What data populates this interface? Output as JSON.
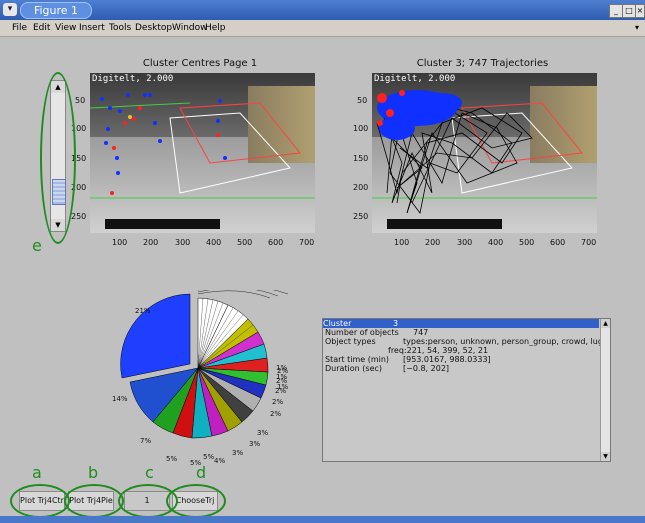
{
  "window": {
    "title": "Figure 1"
  },
  "menu": [
    "File",
    "Edit",
    "View",
    "Insert",
    "Tools",
    "Desktop",
    "Window",
    "Help"
  ],
  "plots": [
    {
      "title": "Cluster Centres Page 1",
      "overlay": "Digitelt, 2.000",
      "y_ticks": [
        "50",
        "100",
        "150",
        "200",
        "250"
      ],
      "x_ticks": [
        "100",
        "200",
        "300",
        "400",
        "500",
        "600",
        "700"
      ]
    },
    {
      "title": "Cluster 3; 747 Trajectories",
      "overlay": "Digitelt, 2.000",
      "y_ticks": [
        "50",
        "100",
        "150",
        "200",
        "250"
      ],
      "x_ticks": [
        "100",
        "200",
        "300",
        "400",
        "500",
        "600",
        "700"
      ]
    }
  ],
  "pie": {
    "labels": [
      "21%",
      "14%",
      "7%",
      "5%",
      "5%",
      "5%",
      "4%",
      "3%",
      "3%",
      "3%",
      "2%",
      "2%",
      "2%",
      "2%",
      "2%",
      "1%",
      "1%",
      "1%"
    ],
    "colors": [
      "#1f3fff",
      "#ffffff",
      "#2050d0",
      "#20a020",
      "#d01010",
      "#10a0b0",
      "#c020c0",
      "#a0a000",
      "#303030",
      "#b0b0b0"
    ]
  },
  "info": {
    "rows": [
      {
        "label": "Cluster",
        "value": "3"
      },
      {
        "label": "Number of objects",
        "value": "747"
      },
      {
        "label": "Object types",
        "value": "types:person, unknown, person_group, crowd, luggage"
      },
      {
        "label": "",
        "value": "freq:221, 54, 399, 52, 21"
      },
      {
        "label": "Start time (min)",
        "value": "[953.0167, 988.0333]"
      },
      {
        "label": "Duration (sec)",
        "value": "[−0.8, 202]"
      }
    ]
  },
  "buttons": {
    "plot_ctr": "Plot Trj4Ctr",
    "plot_pie": "Plot Trj4Pie",
    "edit": "1",
    "choose": "ChooseTrj"
  },
  "callouts": {
    "a": "a",
    "b": "b",
    "c": "c",
    "d": "d",
    "e": "e"
  }
}
